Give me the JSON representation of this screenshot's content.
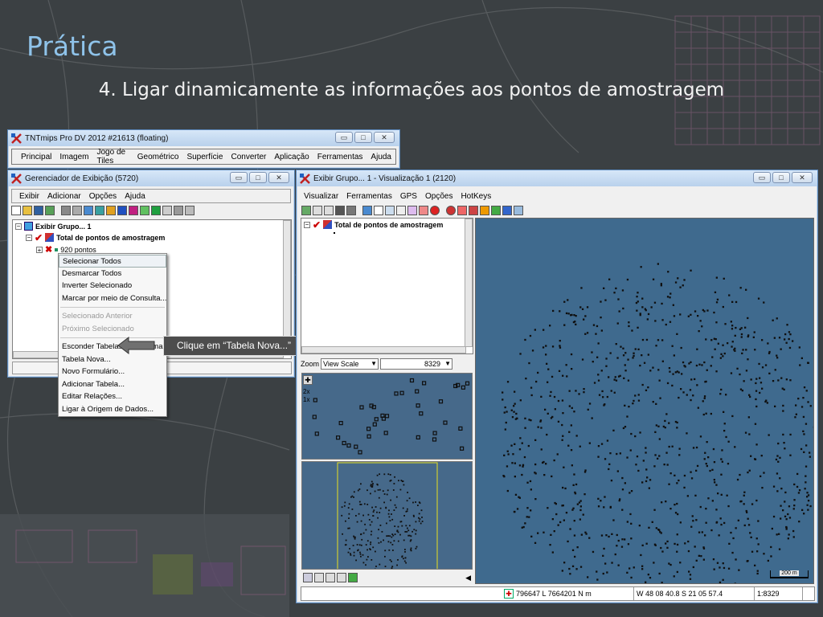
{
  "slide": {
    "title": "Prática",
    "subtitle": "4. Ligar dinamicamente as informações aos pontos de amostragem"
  },
  "tntmips_window": {
    "title": "TNTmips Pro DV 2012  #21613 (floating)",
    "menu": [
      "Principal",
      "Imagem",
      "Jogo de Tiles",
      "Geométrico",
      "Superfície",
      "Converter",
      "Aplicação",
      "Ferramentas",
      "Ajuda"
    ]
  },
  "display_manager": {
    "title": "Gerenciador de Exibição (5720)",
    "menu": [
      "Exibir",
      "Adicionar",
      "Opções",
      "Ajuda"
    ],
    "tree": {
      "group": "Exibir Grupo... 1",
      "layer": "Total de pontos de amostragem",
      "points": "920 pontos"
    }
  },
  "context_menu": {
    "items": [
      {
        "label": "Selecionar Todos",
        "disabled": false,
        "highlight": true
      },
      {
        "label": "Desmarcar Todos",
        "disabled": false
      },
      {
        "label": "Inverter Selecionado",
        "disabled": false
      },
      {
        "label": "Marcar por meio de Consulta...",
        "disabled": false
      },
      {
        "sep": true
      },
      {
        "label": "Selecionado Anterior",
        "disabled": true
      },
      {
        "label": "Próximo Selecionado",
        "disabled": true
      },
      {
        "sep": true
      },
      {
        "label": "Esconder Tabelas do Sistema",
        "disabled": false
      },
      {
        "label": "Tabela Nova...",
        "disabled": false
      },
      {
        "label": "Novo Formulário...",
        "disabled": false
      },
      {
        "label": "Adicionar Tabela...",
        "disabled": false
      },
      {
        "label": "Editar Relações...",
        "disabled": false
      },
      {
        "label": "Ligar à Origem de Dados...",
        "disabled": false
      }
    ]
  },
  "callout": {
    "text": "Clique em “Tabela Nova...”"
  },
  "view_window": {
    "title": "Exibir Grupo... 1 - Visualização 1 (2120)",
    "menu": [
      "Visualizar",
      "Ferramentas",
      "GPS",
      "Opções",
      "HotKeys"
    ],
    "legend_layer": "Total de pontos de amostragem",
    "zoom_label": "Zoom",
    "zoom_mode": "View Scale",
    "zoom_value": "8329",
    "zoom_markers": [
      "2x",
      "1x"
    ],
    "status": {
      "coords_m": "796647 L  7664201 N m",
      "coords_geo": "W 48 08 40.8  S 21 05 57.4",
      "scale": "1:8329"
    },
    "scalebar": "200 m",
    "colors": {
      "map_bg": "#3f6a8e",
      "point": "#0f0f0f"
    }
  }
}
